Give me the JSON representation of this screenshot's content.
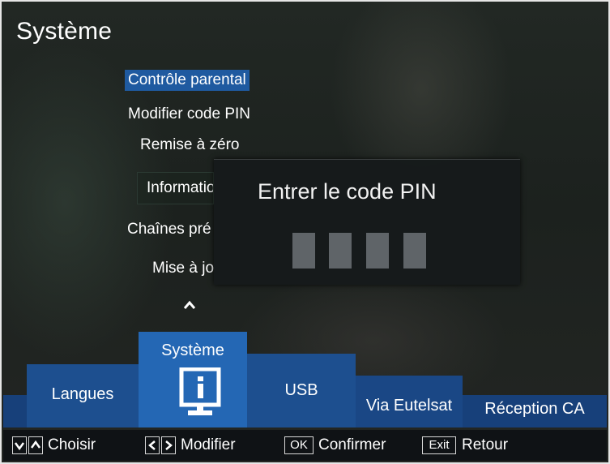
{
  "screen_title": "Système",
  "menu": {
    "items": [
      {
        "label": "Contrôle parental",
        "selected": true
      },
      {
        "label": "Modifier code PIN",
        "selected": false
      },
      {
        "label": "Remise à zéro",
        "selected": false
      },
      {
        "label": "Informatio",
        "selected": false
      },
      {
        "label": "Chaînes pré",
        "selected": false
      },
      {
        "label": "Mise à jo",
        "selected": false
      }
    ],
    "scroll_up_icon": "chevron-up-icon"
  },
  "dialog": {
    "title": "Entrer le code PIN",
    "pin_digits": 4
  },
  "tabs": [
    {
      "label": "Langues",
      "active": false
    },
    {
      "label": "Système",
      "active": true,
      "icon": "info-monitor-icon"
    },
    {
      "label": "USB",
      "active": false
    },
    {
      "label": "Via Eutelsat",
      "active": false
    },
    {
      "label": "Réception CA",
      "active": false
    }
  ],
  "hints": {
    "choose_keys": [
      "v",
      "^"
    ],
    "choose_label": "Choisir",
    "modify_keys": [
      "<",
      ">"
    ],
    "modify_label": "Modifier",
    "ok_key": "OK",
    "ok_label": "Confirmer",
    "exit_key": "Exit",
    "exit_label": "Retour"
  },
  "colors": {
    "accent_blue": "#2467b4",
    "tab_blue": "#1d4f8f",
    "bar_blue": "#17407a",
    "selection_blue": "#1f5aa0"
  }
}
